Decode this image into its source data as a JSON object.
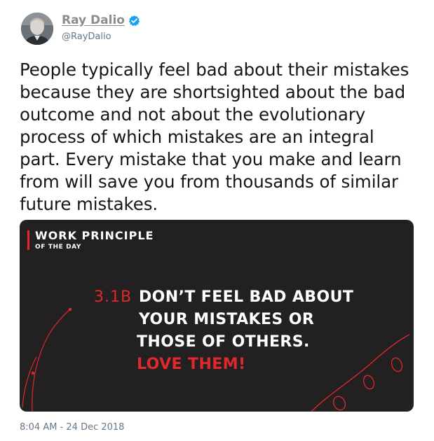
{
  "author": {
    "display_name": "Ray Dalio",
    "handle": "@RayDalio",
    "verified": true,
    "verified_icon": "verified-badge-icon",
    "verified_color": "#1da1f2"
  },
  "tweet": {
    "text": "People typically feel bad about their mistakes because they are shortsighted about the bad outcome and not about the evolutionary process of which mistakes are an integral part. Every mistake that you make and learn from will save you from thousands of similar future mistakes.",
    "timestamp": "8:04 AM - 24 Dec 2018"
  },
  "card": {
    "label": "WORK PRINCIPLE",
    "sublabel": "OF THE DAY",
    "principle_number": "3.1B",
    "lines": [
      "DON’T FEEL BAD ABOUT",
      "YOUR MISTAKES OR",
      "THOSE OF OTHERS.",
      "LOVE THEM!"
    ],
    "accent_color": "#e0282d",
    "background_color": "#232021"
  }
}
